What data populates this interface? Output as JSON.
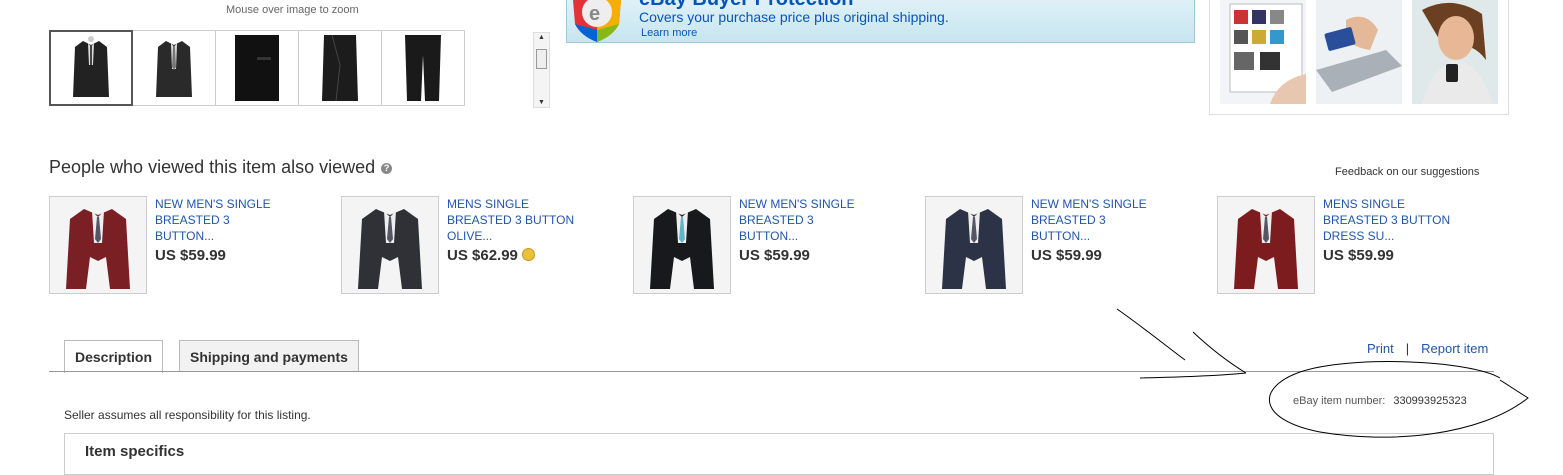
{
  "gallery": {
    "zoom_hint": "Mouse over image to zoom",
    "thumbnails": [
      "thumbnail-1",
      "thumbnail-2",
      "thumbnail-3",
      "thumbnail-4",
      "thumbnail-5"
    ]
  },
  "buyer_protection": {
    "title": "eBay Buyer Protection",
    "subtitle": "Covers your purchase price plus original shipping.",
    "link": "Learn more"
  },
  "also_viewed": {
    "title": "People who viewed this item also viewed",
    "feedback_link": "Feedback on our suggestions",
    "items": [
      {
        "title_lines": [
          "NEW MEN'S SINGLE",
          "BREASTED 3",
          "BUTTON..."
        ],
        "price": "US $59.99",
        "color": "#7a1f24"
      },
      {
        "title_lines": [
          "MENS SINGLE",
          "BREASTED 3 BUTTON",
          "OLIVE..."
        ],
        "price": "US $62.99",
        "color": "#2f3137",
        "top_rated": true
      },
      {
        "title_lines": [
          "NEW MEN'S SINGLE",
          "BREASTED 3",
          "BUTTON..."
        ],
        "price": "US $59.99",
        "color": "#17191c"
      },
      {
        "title_lines": [
          "NEW MEN'S SINGLE",
          "BREASTED 3",
          "BUTTON..."
        ],
        "price": "US $59.99",
        "color": "#2c3346"
      },
      {
        "title_lines": [
          "MENS SINGLE",
          "BREASTED 3 BUTTON",
          "DRESS SU..."
        ],
        "price": "US $59.99",
        "color": "#7c1c1f"
      }
    ]
  },
  "tabs": [
    {
      "label": "Description",
      "active": true
    },
    {
      "label": "Shipping and payments",
      "active": false
    }
  ],
  "actions": {
    "print": "Print",
    "separator": "|",
    "report": "Report item"
  },
  "seller_note": "Seller assumes all responsibility for this listing.",
  "item_number": {
    "label": "eBay item number:",
    "value": "330993925323"
  },
  "item_specifics": {
    "title": "Item specifics"
  }
}
